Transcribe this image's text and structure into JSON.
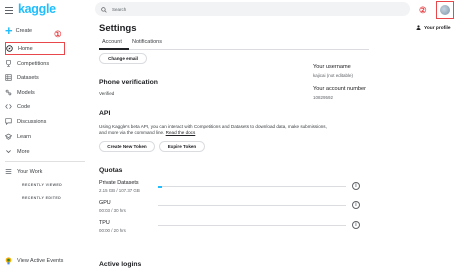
{
  "app": {
    "logo": "kaggle"
  },
  "sidebar": {
    "create_label": "Create",
    "items": [
      {
        "label": "Home",
        "icon": "compass-icon"
      },
      {
        "label": "Competitions",
        "icon": "trophy-icon"
      },
      {
        "label": "Datasets",
        "icon": "table-icon"
      },
      {
        "label": "Models",
        "icon": "models-icon"
      },
      {
        "label": "Code",
        "icon": "code-icon"
      },
      {
        "label": "Discussions",
        "icon": "chat-icon"
      },
      {
        "label": "Learn",
        "icon": "school-icon"
      },
      {
        "label": "More",
        "icon": "chevron-down-icon"
      },
      {
        "label": "Your Work",
        "icon": "list-icon"
      }
    ],
    "recently_viewed": "RECENTLY VIEWED",
    "recently_edited": "RECENTLY EDITED",
    "footer_link": "View Active Events"
  },
  "annotations": {
    "one": "①",
    "two": "②"
  },
  "search": {
    "placeholder": "Search"
  },
  "page": {
    "title": "Settings",
    "profile_link": "Your profile",
    "tabs": [
      {
        "label": "Account",
        "active": true
      },
      {
        "label": "Notifications",
        "active": false
      }
    ]
  },
  "account": {
    "change_email": "Change email",
    "username_label": "Your username",
    "username_value": "kajicai (not editable)",
    "account_number_label": "Your account number",
    "account_number_value": "10829592"
  },
  "phone": {
    "heading": "Phone verification",
    "status": "Verified"
  },
  "api": {
    "heading": "API",
    "description": "Using Kaggle's beta API, you can interact with Competitions and Datasets to download data, make submissions, and more via the command line.",
    "docs_link": "Read the docs",
    "create_token": "Create New Token",
    "expire_token": "Expire Token"
  },
  "quotas": {
    "heading": "Quotas",
    "items": [
      {
        "name": "Private Datasets",
        "usage": "2.15 GB / 107.37 GB",
        "fraction": 0.02
      },
      {
        "name": "GPU",
        "usage": "00:03 / 30 hrs",
        "fraction": 0.0
      },
      {
        "name": "TPU",
        "usage": "00:00 / 20 hrs",
        "fraction": 0.0
      }
    ]
  },
  "active_logins": {
    "heading": "Active logins"
  },
  "colors": {
    "accent": "#20beff",
    "annotation": "#e8474b"
  }
}
